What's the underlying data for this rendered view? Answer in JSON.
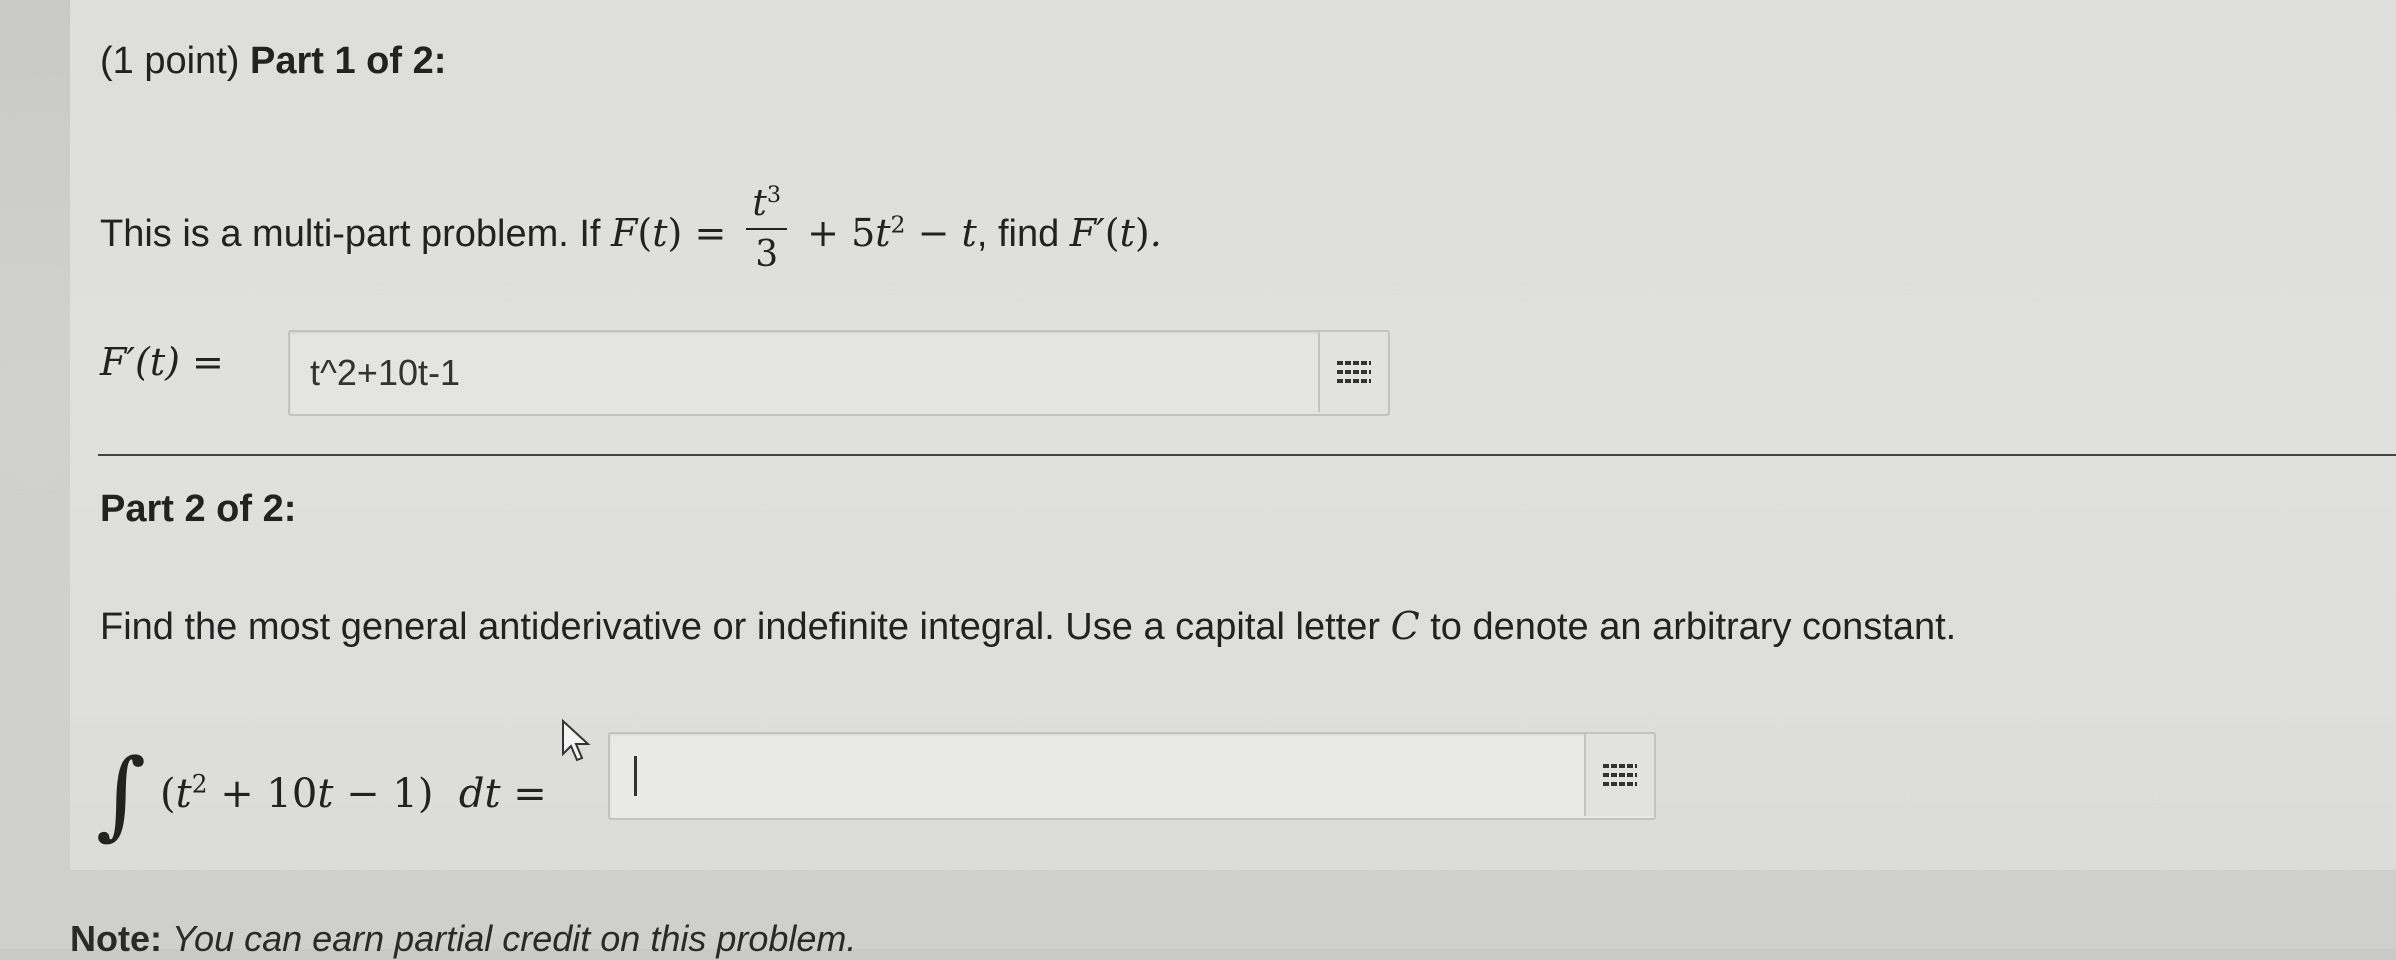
{
  "header": {
    "points": "(1 point)",
    "part_label": "Part 1 of 2:"
  },
  "part1": {
    "intro": "This is a multi-part problem. If",
    "find_text": ", find",
    "answer_label": "F′(t) =",
    "answer_value": "t^2+10t-1"
  },
  "part2": {
    "heading": "Part 2 of 2:",
    "instruction_a": "Find the most general antiderivative or indefinite integral. Use a capital letter",
    "instruction_var": "C",
    "instruction_b": "to denote an arbitrary constant.",
    "answer_value": ""
  },
  "note": {
    "bold": "Note:",
    "text": "You can earn partial credit on this problem."
  },
  "icons": {
    "matrix": "grid-icon",
    "pointer": "mouse-cursor-icon",
    "integral": "integral-sign-icon"
  }
}
